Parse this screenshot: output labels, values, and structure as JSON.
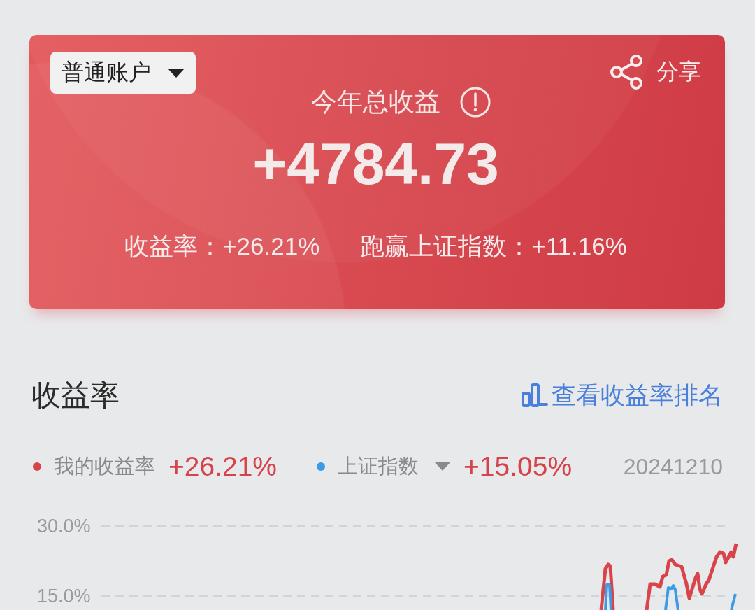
{
  "account_menu": {
    "label": "普通账户"
  },
  "share_button": {
    "label": "分享"
  },
  "summary": {
    "title": "今年总收益",
    "amount": "+4784.73",
    "stats": [
      "收益率：+26.21%",
      "跑赢上证指数：+11.16%"
    ]
  },
  "returns_section": {
    "title": "收益率",
    "ranking_link": "查看收益率排名",
    "legend": [
      {
        "kind": "plain",
        "label": "我的收益率",
        "value": "+26.21%",
        "color": "#d9434a"
      },
      {
        "kind": "picker",
        "label": "上证指数",
        "value": "+15.05%",
        "color": "#3b9be6"
      }
    ],
    "date": "20241210",
    "chart": {
      "y_labels": [
        "30.0%",
        "15.0%"
      ]
    }
  }
}
